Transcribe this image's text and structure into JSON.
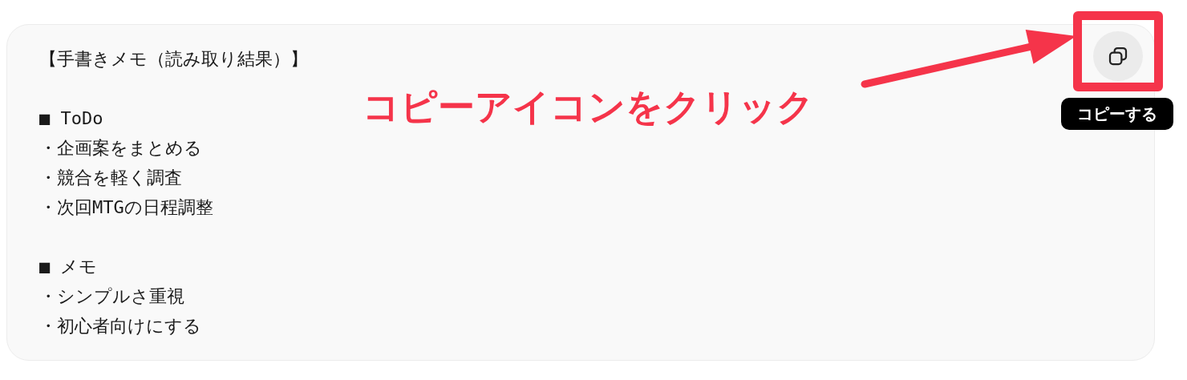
{
  "memo_block": {
    "title": "【手書きメモ（読み取り結果）】",
    "sections": [
      {
        "heading": "■ ToDo",
        "items": [
          "・企画案をまとめる",
          "・競合を軽く調査",
          "・次回MTGの日程調整"
        ]
      },
      {
        "heading": "■ メモ",
        "items": [
          "・シンプルさ重視",
          "・初心者向けにする"
        ]
      }
    ]
  },
  "copy_button": {
    "tooltip": "コピーする"
  },
  "annotation": {
    "text": "コピーアイコンをクリック"
  }
}
